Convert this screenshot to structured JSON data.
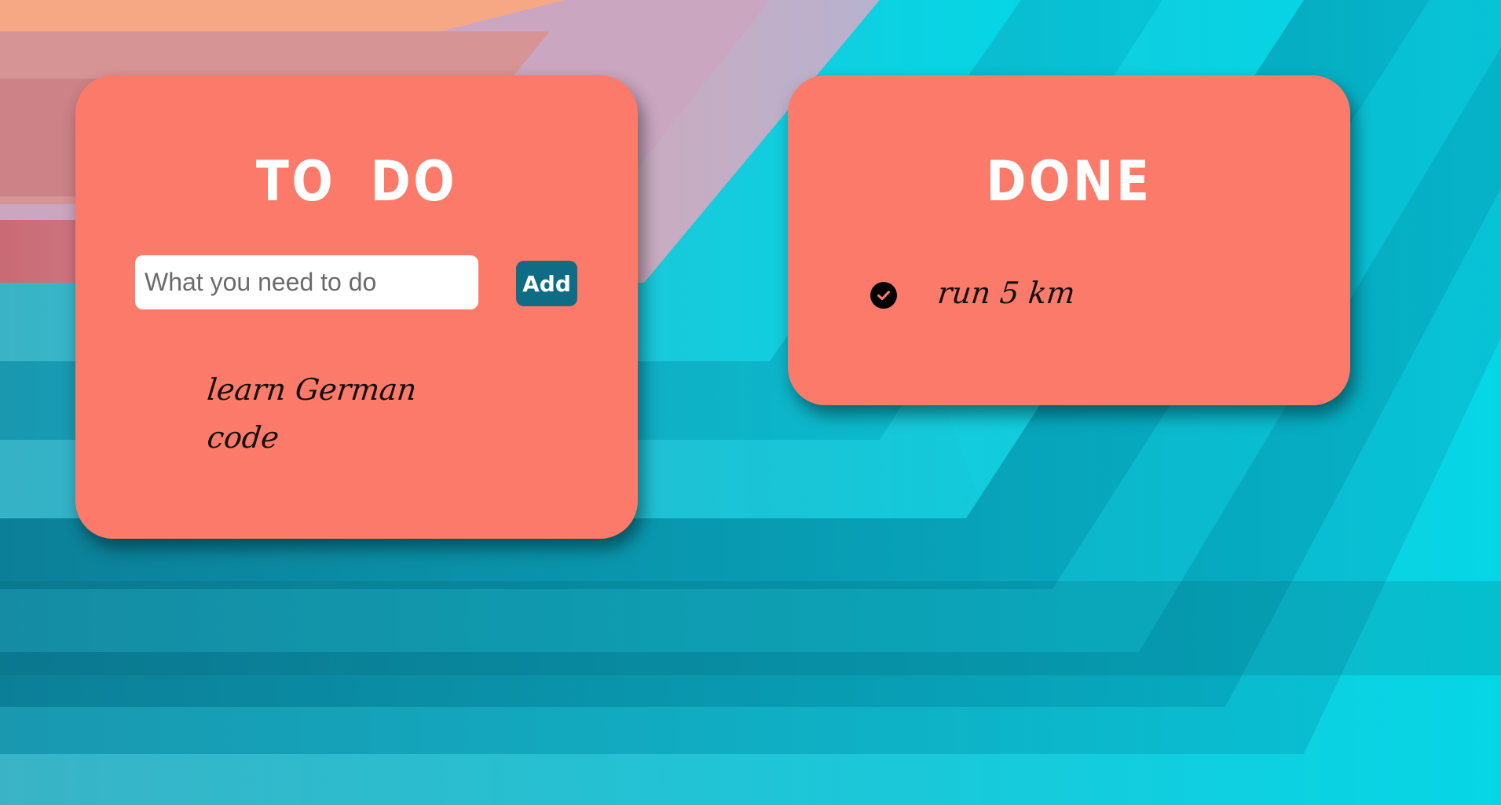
{
  "todo_card": {
    "title": "TO DO",
    "input_value": "",
    "input_placeholder": "What you need to do",
    "add_label": "Add",
    "items": [
      "learn German",
      "code"
    ]
  },
  "done_card": {
    "title": "DONE",
    "items": [
      {
        "label": "run 5 km",
        "icon": "check-circle-icon"
      }
    ]
  },
  "colors": {
    "card": "#fc7a69",
    "button": "#0e6d84",
    "title_text": "#ffffff",
    "item_text": "#111111"
  }
}
